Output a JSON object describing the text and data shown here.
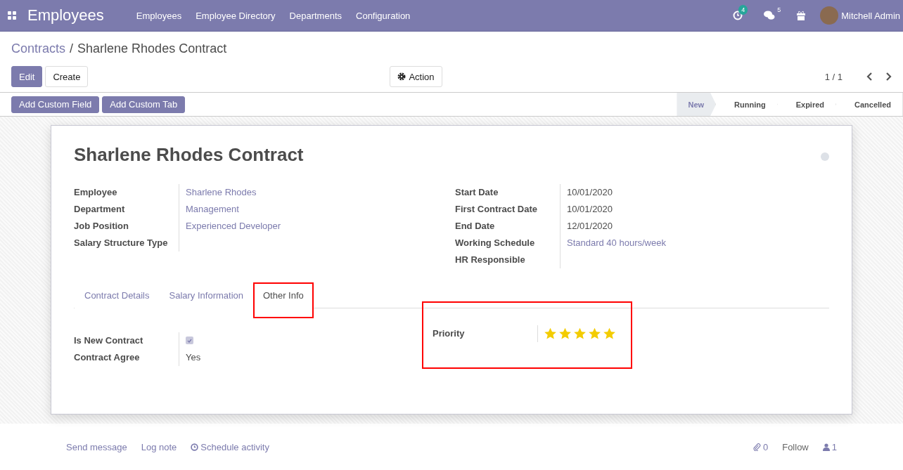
{
  "navbar": {
    "app_title": "Employees",
    "menu": [
      "Employees",
      "Employee Directory",
      "Departments",
      "Configuration"
    ],
    "activity_count": "4",
    "message_count": "5",
    "user": "Mitchell Admin"
  },
  "breadcrumb": {
    "parent": "Contracts",
    "separator": "/",
    "current": "Sharlene Rhodes Contract"
  },
  "buttons": {
    "edit": "Edit",
    "create": "Create",
    "action": "Action"
  },
  "pager": "1 / 1",
  "custom_buttons": [
    "Add Custom Field",
    "Add Custom Tab"
  ],
  "stages": [
    {
      "label": "New",
      "selected": true
    },
    {
      "label": "Running",
      "selected": false
    },
    {
      "label": "Expired",
      "selected": false
    },
    {
      "label": "Cancelled",
      "selected": false
    }
  ],
  "sheet": {
    "title": "Sharlene Rhodes Contract",
    "left_fields": [
      {
        "label": "Employee",
        "value": "Sharlene Rhodes",
        "link": true
      },
      {
        "label": "Department",
        "value": "Management",
        "link": true
      },
      {
        "label": "Job Position",
        "value": "Experienced Developer",
        "link": true
      },
      {
        "label": "Salary Structure Type"
      }
    ],
    "right_fields": [
      {
        "label": "Start Date",
        "value": "10/01/2020",
        "link": false
      },
      {
        "label": "First Contract Date",
        "value": "10/01/2020",
        "link": false
      },
      {
        "label": "End Date",
        "value": "12/01/2020",
        "link": false
      },
      {
        "label": "Working Schedule",
        "value": "Standard 40 hours/week",
        "link": true
      },
      {
        "label": "HR Responsible"
      }
    ],
    "tabs": [
      {
        "label": "Contract Details",
        "selected": false,
        "highlighted": false
      },
      {
        "label": "Salary Information",
        "selected": false,
        "highlighted": false
      },
      {
        "label": "Other Info",
        "selected": true,
        "highlighted": true
      }
    ],
    "other_info": {
      "is_new_contract": {
        "label": "Is New Contract",
        "checked": true
      },
      "contract_agree": {
        "label": "Contract Agree",
        "value": "Yes"
      },
      "priority": {
        "label": "Priority",
        "stars": 5,
        "highlighted": true
      }
    }
  },
  "chatter": {
    "send_message": "Send message",
    "log_note": "Log note",
    "schedule_activity": "Schedule activity",
    "attachments": "0",
    "follow": "Follow",
    "followers": "1"
  }
}
